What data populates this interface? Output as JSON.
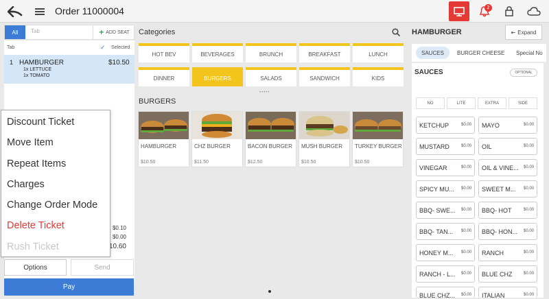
{
  "header": {
    "title": "Order 11000004",
    "notification_count": "2",
    "accent_color": "#e53935"
  },
  "seat_bar": {
    "all_label": "All",
    "tab_placeholder": "Tab",
    "add_seat_label": "ADD SEAT"
  },
  "ticket": {
    "tab_label": "Tab",
    "selected_label": "Selected",
    "item": {
      "qty": "1",
      "name": "HAMBURGER",
      "price": "$10.50",
      "modifiers": [
        "1x LETTUCE",
        "1x TOMATO"
      ]
    },
    "tax_values": [
      "$0.10",
      "$0.00"
    ],
    "total_partial": "10.60"
  },
  "context_menu": {
    "items": [
      {
        "label": "Discount Ticket",
        "state": "normal"
      },
      {
        "label": "Move Item",
        "state": "normal"
      },
      {
        "label": "Repeat Items",
        "state": "normal"
      },
      {
        "label": "Charges",
        "state": "normal"
      },
      {
        "label": "Change Order Mode",
        "state": "normal"
      },
      {
        "label": "Delete Ticket",
        "state": "danger"
      },
      {
        "label": "Rush Ticket",
        "state": "disabled"
      }
    ]
  },
  "actions": {
    "options_label": "Options",
    "send_label": "Send",
    "pay_label": "Pay"
  },
  "categories": {
    "title": "Categories",
    "selected": "BURGERS",
    "items": [
      "HOT BEV",
      "BEVERAGES",
      "BRUNCH",
      "BREAKFAST",
      "LUNCH",
      "DINNER",
      "BURGERS",
      "SALADS",
      "SANDWICH",
      "KIDS"
    ]
  },
  "products": {
    "title": "BURGERS",
    "items": [
      {
        "name": "HAMBURGER",
        "price": "$10.50"
      },
      {
        "name": "CHZ BURGER",
        "price": "$11.50"
      },
      {
        "name": "BACON BURGER",
        "price": "$12.50"
      },
      {
        "name": "MUSH BURGER",
        "price": "$10.50"
      },
      {
        "name": "TURKEY BURGER",
        "price": "$10.50"
      }
    ]
  },
  "modifiers": {
    "title": "HAMBURGER",
    "expand_label": "Expand",
    "tabs": [
      "SAUCES",
      "BURGER CHEESE",
      "Special No"
    ],
    "section_title": "SAUCES",
    "optional_label": "OPTIONAL",
    "modes": [
      "NO",
      "LITE",
      "EXTRA",
      "SIDE"
    ],
    "items": [
      {
        "name": "KETCHUP",
        "price": "$0.00"
      },
      {
        "name": "MAYO",
        "price": "$0.00"
      },
      {
        "name": "MUSTARD",
        "price": "$0.00"
      },
      {
        "name": "OIL",
        "price": "$0.00"
      },
      {
        "name": "VINEGAR",
        "price": "$0.00"
      },
      {
        "name": "OIL & VINE...",
        "price": "$0.00"
      },
      {
        "name": "SPICY MU...",
        "price": "$0.00"
      },
      {
        "name": "SWEET M...",
        "price": "$0.00"
      },
      {
        "name": "BBQ- SWE...",
        "price": "$0.00"
      },
      {
        "name": "BBQ- HOT",
        "price": "$0.00"
      },
      {
        "name": "BBQ- TAN...",
        "price": "$0.00"
      },
      {
        "name": "BBQ- HON...",
        "price": "$0.00"
      },
      {
        "name": "HONEY M...",
        "price": "$0.00"
      },
      {
        "name": "RANCH",
        "price": "$0.00"
      },
      {
        "name": "RANCH - L...",
        "price": "$0.00"
      },
      {
        "name": "BLUE CHZ",
        "price": "$0.00"
      },
      {
        "name": "BLUE CHZ...",
        "price": "$0.00"
      },
      {
        "name": "ITALIAN",
        "price": "$0.00"
      }
    ]
  },
  "icons": [
    "back-arrow-icon",
    "hamburger-menu-icon",
    "display-icon",
    "bell-icon",
    "lock-icon",
    "cloud-icon",
    "search-icon",
    "plus-icon",
    "check-icon"
  ]
}
